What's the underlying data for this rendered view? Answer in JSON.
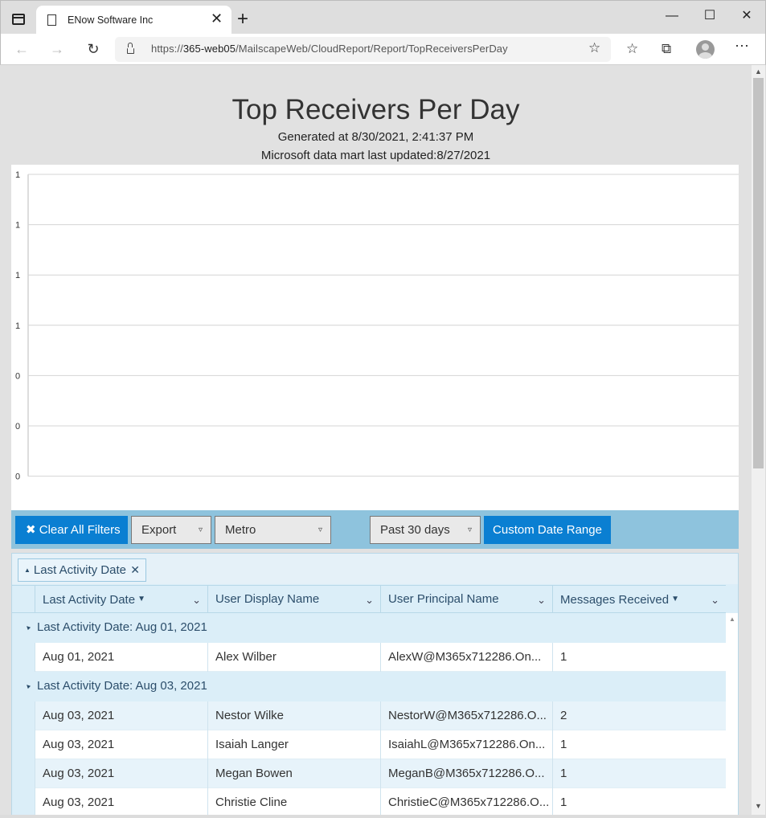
{
  "browser": {
    "tab_title": "ENow Software Inc",
    "url_prefix": "https://",
    "url_host": "365-web05",
    "url_path": "/MailscapeWeb/CloudReport/Report/TopReceiversPerDay"
  },
  "report": {
    "title": "Top Receivers Per Day",
    "generated": "Generated at 8/30/2021, 2:41:37 PM",
    "datamart": "Microsoft data mart last updated:8/27/2021"
  },
  "chart_data": {
    "type": "bar",
    "y_tick_labels": [
      "1",
      "1",
      "1",
      "1",
      "0",
      "0",
      "0"
    ],
    "grid": true,
    "series": []
  },
  "filters": {
    "clear_all": "Clear All Filters",
    "export": "Export",
    "theme": "Metro",
    "range": "Past 30 days",
    "custom_range": "Custom Date Range"
  },
  "grid": {
    "group_chip": "Last Activity Date",
    "columns": [
      "Last Activity Date",
      "User Display Name",
      "User Principal Name",
      "Messages Received"
    ],
    "groups": [
      {
        "label": "Last Activity Date: Aug 01, 2021",
        "rows": [
          [
            "Aug 01, 2021",
            "Alex Wilber",
            "AlexW@M365x712286.On...",
            "1"
          ]
        ]
      },
      {
        "label": "Last Activity Date: Aug 03, 2021",
        "rows": [
          [
            "Aug 03, 2021",
            "Nestor Wilke",
            "NestorW@M365x712286.O...",
            "2"
          ],
          [
            "Aug 03, 2021",
            "Isaiah Langer",
            "IsaiahL@M365x712286.On...",
            "1"
          ],
          [
            "Aug 03, 2021",
            "Megan Bowen",
            "MeganB@M365x712286.O...",
            "1"
          ],
          [
            "Aug 03, 2021",
            "Christie Cline",
            "ChristieC@M365x712286.O...",
            "1"
          ]
        ]
      }
    ]
  }
}
